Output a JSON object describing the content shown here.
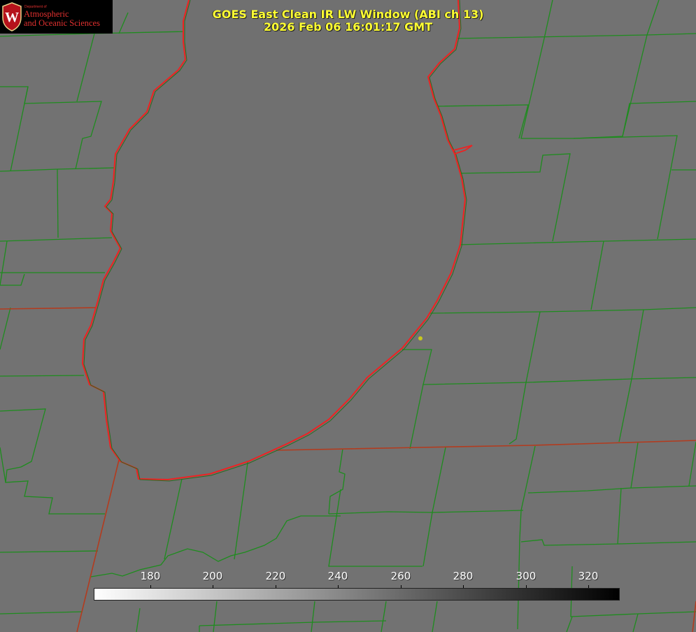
{
  "title": {
    "line1": "GOES East Clean IR LW Window (ABI ch 13)",
    "line2": "2026 Feb 06 16:01:17 GMT"
  },
  "logo": {
    "department": "Department of",
    "line1": "Atmospheric",
    "line2": "and Oceanic Sciences",
    "crest_letter": "W"
  },
  "colorbar": {
    "ticks": [
      "180",
      "200",
      "220",
      "240",
      "260",
      "280",
      "300",
      "320"
    ],
    "gradient_from": "#ffffff",
    "gradient_to": "#000000"
  },
  "colors": {
    "background": "#727272",
    "lake": "#6e6e6e",
    "county_lines": "#1e8c1e",
    "state_lines": "#b33b1e",
    "shoreline": "#ee2222",
    "title_text": "#ffff33",
    "marker": "#c8c81e"
  }
}
